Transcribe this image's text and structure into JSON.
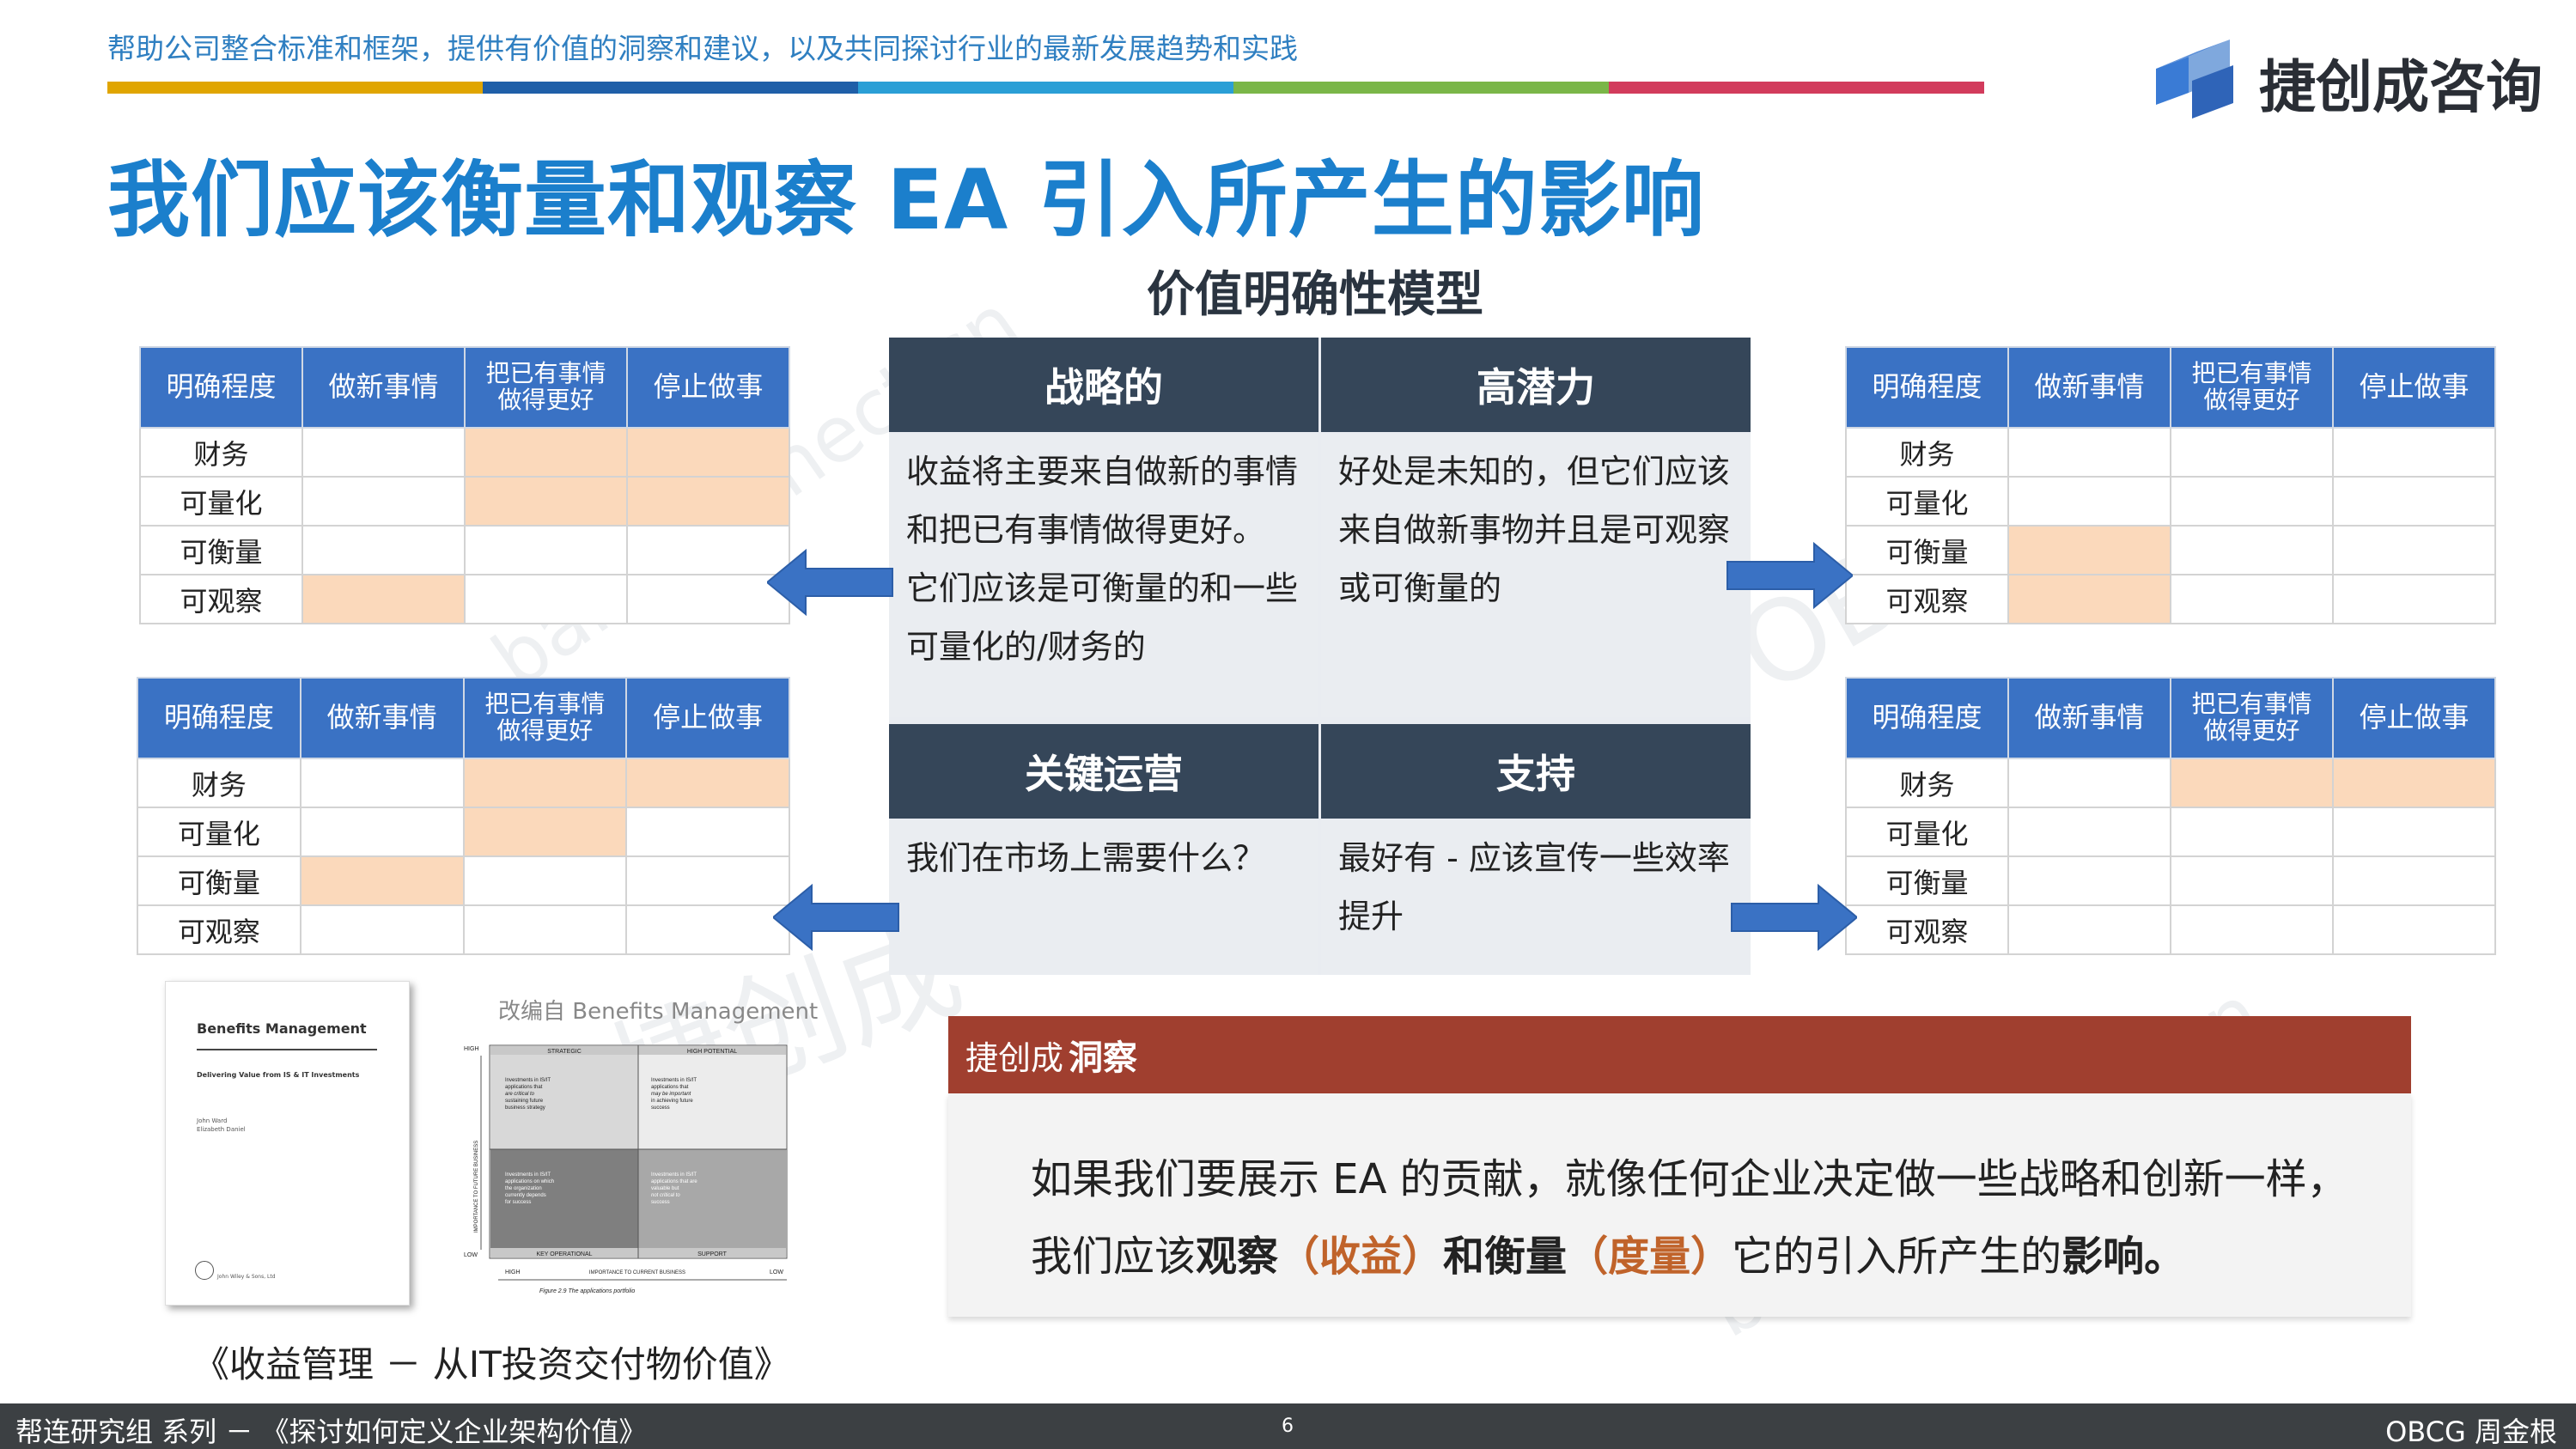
{
  "header": {
    "tagline": "帮助公司整合标准和框架，提供有价值的洞察和建议，以及共同探讨行业的最新发展趋势和实践",
    "colorbar": [
      "#e0a500",
      "#1f5fa8",
      "#2a9fd6",
      "#7ab648",
      "#d23b5c"
    ],
    "logo_text": "捷创成咨询",
    "logo_icon": "cube-logo-icon"
  },
  "title": "我们应该衡量和观察 EA 引入所产生的影响",
  "model_title": "价值明确性模型",
  "table_headers": {
    "clarity": "明确程度",
    "new": "做新事情",
    "better_line1": "把已有事情",
    "better_line2": "做得更好",
    "stop": "停止做事"
  },
  "table_rows": [
    "财务",
    "可量化",
    "可衡量",
    "可观察"
  ],
  "tables": {
    "top_left": {
      "highlights": [
        [
          false,
          true,
          true
        ],
        [
          false,
          true,
          true
        ],
        [
          false,
          false,
          false
        ],
        [
          true,
          false,
          false
        ]
      ]
    },
    "bottom_left": {
      "highlights": [
        [
          false,
          true,
          true
        ],
        [
          false,
          true,
          false
        ],
        [
          true,
          false,
          false
        ],
        [
          false,
          false,
          false
        ]
      ]
    },
    "top_right": {
      "highlights": [
        [
          false,
          false,
          false
        ],
        [
          false,
          false,
          false
        ],
        [
          true,
          false,
          false
        ],
        [
          true,
          false,
          false
        ]
      ]
    },
    "bottom_right": {
      "highlights": [
        [
          false,
          true,
          true
        ],
        [
          false,
          false,
          false
        ],
        [
          false,
          false,
          false
        ],
        [
          false,
          false,
          false
        ]
      ]
    }
  },
  "quadrants": {
    "strategic": {
      "title": "战略的",
      "lines": [
        "收益将主要来自做新的事情",
        "和把已有事情做得更好。",
        "它们应该是可衡量的和一些",
        "可量化的/财务的"
      ]
    },
    "high_potential": {
      "title": "高潜力",
      "lines": [
        "好处是未知的，但它们应该",
        "来自做新事物并且是可观察",
        "或可衡量的"
      ]
    },
    "key_operational": {
      "title": "关键运营",
      "lines": [
        "我们在市场上需要什么？"
      ]
    },
    "support": {
      "title": "支持",
      "lines": [
        "最好有 - 应该宣传一些效率",
        "提升"
      ]
    }
  },
  "book": {
    "title": "Benefits Management",
    "subtitle": "Delivering Value from IS & IT Investments",
    "author1": "John Ward",
    "author2": "Elizabeth Daniel",
    "publisher": "John Wiley & Sons, Ltd"
  },
  "adapted_from": "改编自 Benefits Management",
  "mini_chart": {
    "high": "HIGH",
    "low": "LOW",
    "strategic": "STRATEGIC",
    "high_potential": "HIGH POTENTIAL",
    "key_operational": "KEY OPERATIONAL",
    "support": "SUPPORT",
    "y_axis": "IMPORTANCE TO FUTURE BUSINESS",
    "x_axis": "IMPORTANCE TO CURRENT BUSINESS",
    "x_high": "HIGH",
    "x_low": "LOW",
    "figure": "Figure 2.9  The applications portfolio",
    "cell_tl": [
      "Investments in IS/IT",
      "applications that",
      "are critical to",
      "sustaining future",
      "business strategy"
    ],
    "cell_tr": [
      "Investments in IS/IT",
      "applications that",
      "may be important",
      "in achieving future",
      "success"
    ],
    "cell_bl": [
      "Investments in IS/IT",
      "applications on which",
      "the organization",
      "currently depends",
      "for success"
    ],
    "cell_br": [
      "Investments in IS/IT",
      "applications that are",
      "valuable but",
      "not critical to",
      "success"
    ]
  },
  "caption": "《收益管理 － 从IT投资交付物价值》",
  "insight": {
    "label_brand": "捷创成",
    "label_title": "洞察",
    "line1": "如果我们要展示 EA 的贡献，就像任何企业决定做一些战略和创新一样，",
    "line2_a": "我们应该",
    "line2_b": "观察",
    "line2_c": "（收益）",
    "line2_d": "和衡量",
    "line2_e": "（度量）",
    "line2_f": "它的引入所产生的",
    "line2_g": "影响",
    "line2_h": "。"
  },
  "watermarks": [
    "bangconnect.cn",
    "OBCG",
    "捷创成",
    "bangconnect.cn"
  ],
  "footer": {
    "left": "帮连研究组 系列 － 《探讨如何定义企业架构价值》",
    "page": "6",
    "right": "OBCG 周金根"
  },
  "colors": {
    "table_header": "#3a72c4",
    "highlight": "#fbd9bb",
    "quadrant_header": "#354659",
    "arrow": "#3a72c4",
    "insight_header": "#a03f2f",
    "title": "#1b7fcc"
  }
}
